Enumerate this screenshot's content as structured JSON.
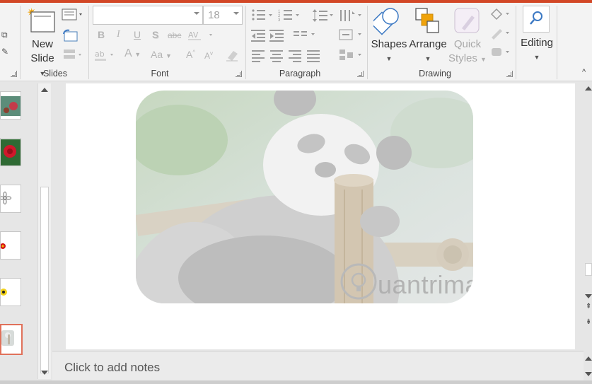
{
  "ribbon": {
    "new_slide_top": "New",
    "new_slide_bottom": "Slide",
    "font_name": "",
    "font_size": "18",
    "shapes_label": "Shapes",
    "arrange_label": "Arrange",
    "quick_styles_top": "Quick",
    "quick_styles_bottom": "Styles",
    "editing_label": "Editing",
    "groups": {
      "slides": "Slides",
      "font": "Font",
      "paragraph": "Paragraph",
      "drawing": "Drawing"
    },
    "font_buttons": {
      "bold": "B",
      "italic": "I",
      "underline": "U",
      "shadow": "S",
      "strike": "abc",
      "font_color": "A",
      "case": "Aa",
      "grow": "A",
      "shrink": "A"
    },
    "accent_color": "#d24726"
  },
  "notes": {
    "placeholder": "Click to add notes"
  },
  "watermark": {
    "text": "uantrimang"
  },
  "thumbnails": [
    {
      "icon": "red-flower-thumbnail"
    },
    {
      "icon": "rose-thumbnail"
    },
    {
      "icon": "outline-flower-thumbnail"
    },
    {
      "icon": "red-flower-clipart-thumbnail"
    },
    {
      "icon": "yellow-flower-thumbnail"
    },
    {
      "icon": "panda-thumbnail",
      "selected": true
    }
  ]
}
